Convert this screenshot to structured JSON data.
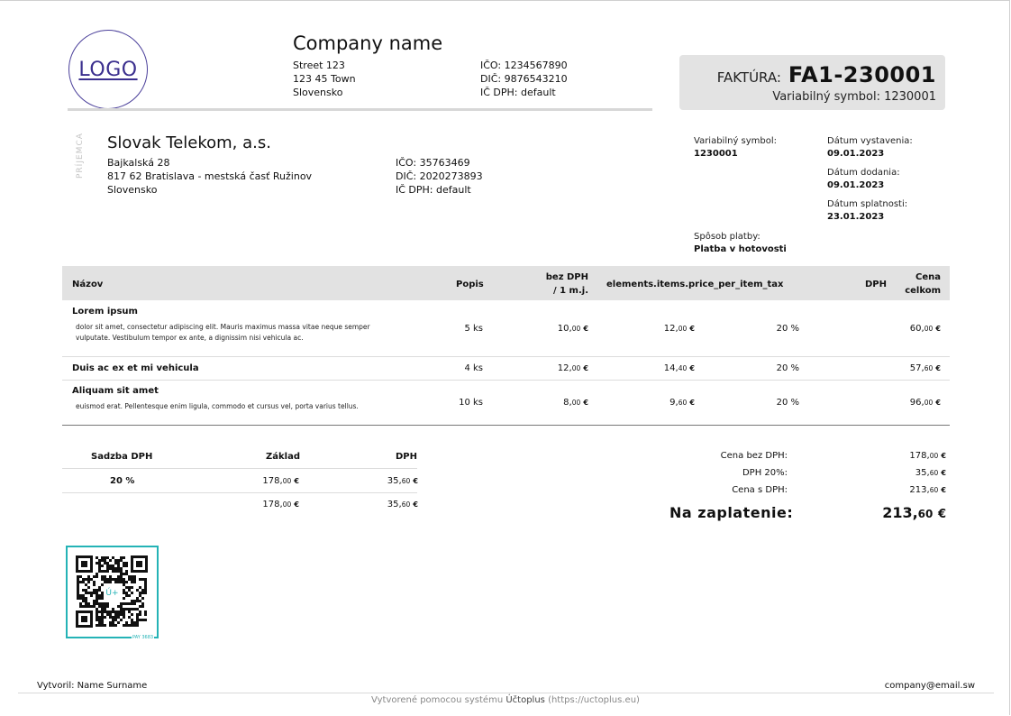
{
  "supplier": {
    "logo_text": "LOGO",
    "name": "Company name",
    "street": "Street 123",
    "city": "123 45 Town",
    "country": "Slovensko",
    "ico": "IČO: 1234567890",
    "dic": "DIČ: 9876543210",
    "icdph": "IČ DPH: default"
  },
  "invoice": {
    "label": "FAKTÚRA:",
    "number": "FA1-230001",
    "variable_symbol_line": "Variabilný symbol: 1230001"
  },
  "customer": {
    "section_label": "PRÍJEMCA",
    "name": "Slovak Telekom, a.s.",
    "street": "Bajkalská 28",
    "city": "817 62 Bratislava - mestská časť Ružinov",
    "country": "Slovensko",
    "ico": "IČO: 35763469",
    "dic": "DIČ: 2020273893",
    "icdph": "IČ DPH: default"
  },
  "meta": {
    "vs_label": "Variabilný symbol:",
    "vs_value": "1230001",
    "issue_label": "Dátum vystavenia:",
    "issue_value": "09.01.2023",
    "delivery_label": "Dátum dodania:",
    "delivery_value": "09.01.2023",
    "due_label": "Dátum splatnosti:",
    "due_value": "23.01.2023",
    "payment_label": "Spôsob platby:",
    "payment_value": "Platba v hotovosti"
  },
  "items_table": {
    "headers": {
      "name": "Názov",
      "desc": "Popis",
      "unit_price_line1": "bez DPH",
      "unit_price_line2": "/ 1 m.j.",
      "price_tax": "elements.items.price_per_item_tax",
      "vat": "DPH",
      "total_line1": "Cena",
      "total_line2": "celkom"
    },
    "rows": [
      {
        "name": "Lorem ipsum",
        "desc_line1": "dolor sit amet, consectetur adipiscing elit. Mauris maximus massa vitae neque semper",
        "desc_line2": "vulputate. Vestibulum tempor ex ante, a dignissim nisi vehicula ac.",
        "qty": "5 ks",
        "unit_int": "10,",
        "unit_cents": "00",
        "unit_cur": "€",
        "tax_int": "12,",
        "tax_cents": "00",
        "tax_cur": "€",
        "vat": "20 %",
        "total_int": "60,",
        "total_cents": "00",
        "total_cur": "€"
      },
      {
        "name": "Duis ac ex et mi vehicula",
        "qty": "4 ks",
        "unit_int": "12,",
        "unit_cents": "00",
        "unit_cur": "€",
        "tax_int": "14,",
        "tax_cents": "40",
        "tax_cur": "€",
        "vat": "20 %",
        "total_int": "57,",
        "total_cents": "60",
        "total_cur": "€"
      },
      {
        "name": "Aliquam sit amet",
        "desc_line1": "euismod erat. Pellentesque enim ligula, commodo et cursus vel, porta varius tellus.",
        "qty": "10 ks",
        "unit_int": "8,",
        "unit_cents": "00",
        "unit_cur": "€",
        "tax_int": "9,",
        "tax_cents": "60",
        "tax_cur": "€",
        "vat": "20 %",
        "total_int": "96,",
        "total_cents": "00",
        "total_cur": "€"
      }
    ]
  },
  "vat_table": {
    "headers": {
      "rate": "Sadzba DPH",
      "base": "Základ",
      "vat": "DPH"
    },
    "row": {
      "rate": "20 %",
      "base_int": "178,",
      "base_cents": "00",
      "vat_int": "35,",
      "vat_cents": "60",
      "cur": "€"
    },
    "sum": {
      "base_int": "178,",
      "base_cents": "00",
      "vat_int": "35,",
      "vat_cents": "60",
      "cur": "€"
    }
  },
  "totals": {
    "no_vat_label": "Cena bez DPH:",
    "no_vat_int": "178,",
    "no_vat_cents": "00",
    "vat_label": "DPH 20%:",
    "vat_int": "35,",
    "vat_cents": "60",
    "with_vat_label": "Cena s DPH:",
    "with_vat_int": "213,",
    "with_vat_cents": "60",
    "cur": "€",
    "pay_label": "Na zaplatenie:",
    "pay_int": "213,",
    "pay_cents": "60"
  },
  "qr": {
    "caption": "PAY 3683",
    "center_text": "Ú+"
  },
  "footer": {
    "created_by": "Vytvoril: Name Surname",
    "email": "company@email.sw",
    "credit_prefix": "Vytvorené pomocou systému",
    "credit_brand": "Účtoplus",
    "credit_url": "(https://uctoplus.eu)"
  },
  "colors": {
    "logo": "#3b2f8e",
    "qr_frame": "#24b3b6",
    "header_band": "#e2e2e2"
  }
}
